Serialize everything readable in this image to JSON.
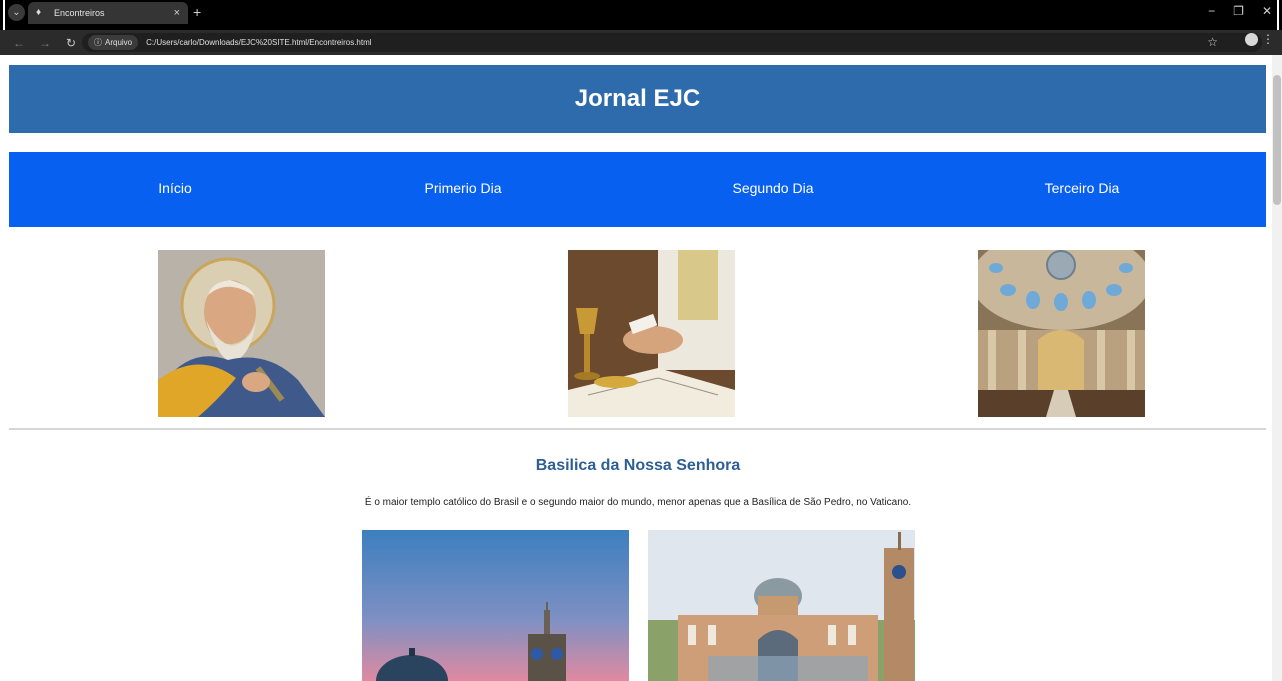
{
  "browser": {
    "tab_title": "Encontreiros",
    "tab_close": "×",
    "new_tab": "+",
    "site_info_label": "Arquivo",
    "url": "C:/Users/carlo/Downloads/EJC%20SITE.html/Encontreiros.html",
    "window_controls": [
      "−",
      "❐",
      "✕"
    ]
  },
  "page": {
    "header_title": "Jornal EJC",
    "nav": [
      "Início",
      "Primerio Dia",
      "Segundo Dia",
      "Terceiro Dia"
    ],
    "section_title": "Basilica da Nossa Senhora",
    "section_text": "É o maior templo católico do Brasil e o segundo maior do mundo, menor apenas que a Basílica de São Pedro, no Vaticano."
  },
  "colors": {
    "header_bg": "#2d6bad",
    "nav_bg": "#0860f0",
    "section_title": "#2d5f93"
  },
  "icons": {
    "tab_search": "chevron-down-icon",
    "favicon": "page-favicon-icon",
    "back": "arrow-left-icon",
    "forward": "arrow-right-icon",
    "reload": "reload-icon",
    "site_info": "info-icon",
    "bookmark": "star-icon",
    "profile": "profile-icon",
    "menu": "kebab-menu-icon"
  }
}
